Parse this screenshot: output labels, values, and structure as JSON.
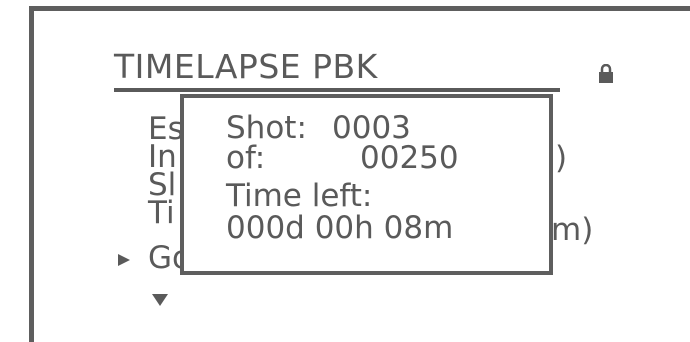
{
  "screen": {
    "title": "TIMELAPSE PBK",
    "lock_icon": "lock-icon"
  },
  "menu": {
    "rows": [
      {
        "label": "Es"
      },
      {
        "label": "In",
        "suffix": ")"
      },
      {
        "label": "Sl"
      },
      {
        "label": "Ti",
        "suffix": "m)"
      },
      {
        "label": "Go"
      }
    ],
    "cursor_icon": "triangle-right-icon",
    "scroll_icon": "triangle-down-icon"
  },
  "popup": {
    "shot_label": "Shot:",
    "shot_value": "0003",
    "of_label": "of:",
    "of_value": "00250",
    "time_left_label": "Time left:",
    "time_left_value": "000d 00h 08m"
  },
  "colors": {
    "ink": "#5a5a5a",
    "background": "#ffffff"
  }
}
